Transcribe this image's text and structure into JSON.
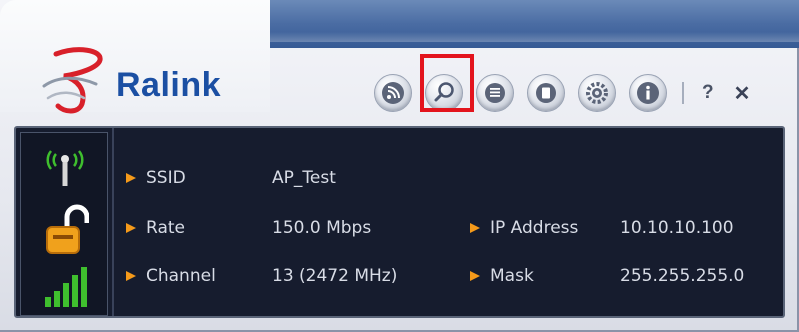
{
  "brand": {
    "name": "Ralink"
  },
  "toolbar": {
    "buttons": [
      {
        "icon": "rss-profile-icon"
      },
      {
        "icon": "search-icon",
        "highlighted": true
      },
      {
        "icon": "list-icon"
      },
      {
        "icon": "page-icon"
      },
      {
        "icon": "gear-icon"
      },
      {
        "icon": "info-icon"
      }
    ],
    "help_label": "?",
    "close_label": "✕"
  },
  "status": {
    "signal_icon": "antenna-icon",
    "lock_icon": "unlocked-padlock-icon",
    "strength_icon": "signal-bars-icon"
  },
  "connection": {
    "ssid_label": "SSID",
    "ssid_value": "AP_Test",
    "rate_label": "Rate",
    "rate_value": "150.0 Mbps",
    "channel_label": "Channel",
    "channel_value": "13 (2472 MHz)",
    "ip_label": "IP Address",
    "ip_value": "10.10.10.100",
    "mask_label": "Mask",
    "mask_value": "255.255.255.0"
  },
  "colors": {
    "panel_bg": "#161c2e",
    "accent_orange": "#f59a1a",
    "highlight_red": "#e3141d",
    "brand_blue": "#1b4fa3",
    "signal_green": "#3fbf2e"
  }
}
